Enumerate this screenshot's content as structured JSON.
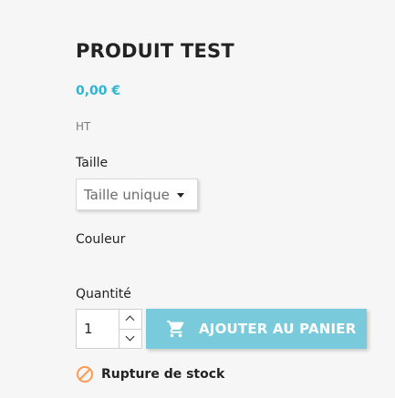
{
  "product": {
    "title": "PRODUIT TEST",
    "price": "0,00 €",
    "tax_label": "HT"
  },
  "size": {
    "label": "Taille",
    "selected": "Taille unique",
    "options": [
      "Taille unique"
    ]
  },
  "color": {
    "label": "Couleur"
  },
  "quantity": {
    "label": "Quantité",
    "value": "1"
  },
  "add_to_cart": {
    "label": "AJOUTER AU PANIER",
    "icon": "cart-icon"
  },
  "availability": {
    "label": "Rupture de stock",
    "icon": "unavailable-icon",
    "color": "#ff9a52"
  },
  "colors": {
    "accent": "#2fb5d2",
    "button": "#79cbdc",
    "text": "#232323"
  }
}
